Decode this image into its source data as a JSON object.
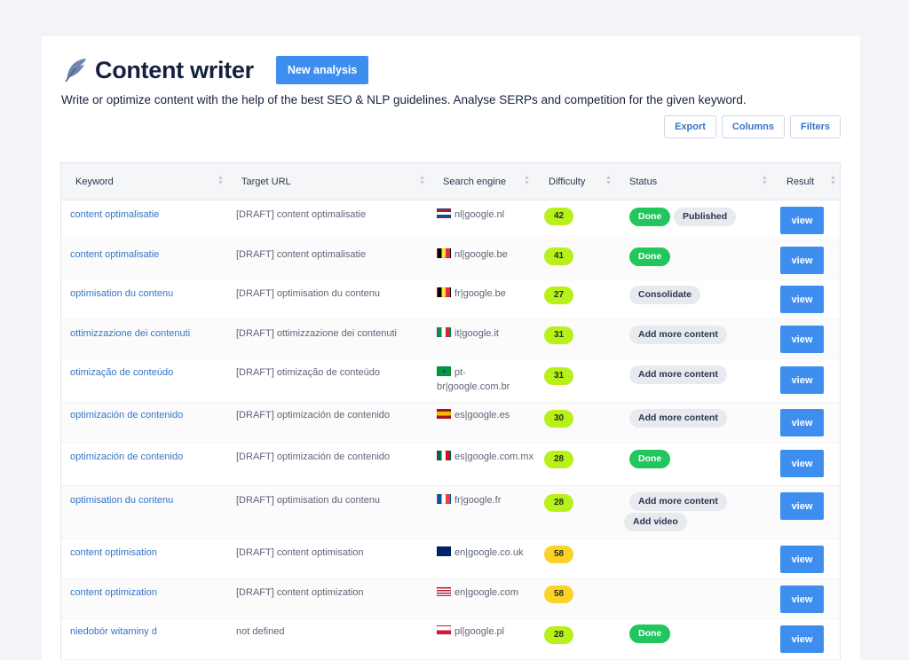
{
  "header": {
    "title": "Content writer",
    "new_analysis_label": "New analysis",
    "subtitle": "Write or optimize content with the help of the best SEO & NLP guidelines. Analyse SERPs and competition for the given keyword."
  },
  "toolbar": {
    "export_label": "Export",
    "columns_label": "Columns",
    "filters_label": "Filters"
  },
  "table": {
    "columns": [
      "Keyword",
      "Target URL",
      "Search engine",
      "Difficulty",
      "Status",
      "Result"
    ],
    "view_label": "view",
    "rows": [
      {
        "keyword": "content optimalisatie",
        "target_url": "[DRAFT] content optimalisatie",
        "flag": "nl",
        "engine": "nl|google.nl",
        "difficulty": "42",
        "status": [
          "Done",
          "Published"
        ]
      },
      {
        "keyword": "content optimalisatie",
        "target_url": "[DRAFT] content optimalisatie",
        "flag": "be",
        "engine": "nl|google.be",
        "difficulty": "41",
        "status": [
          "Done"
        ]
      },
      {
        "keyword": "optimisation du contenu",
        "target_url": "[DRAFT] optimisation du contenu",
        "flag": "be",
        "engine": "fr|google.be",
        "difficulty": "27",
        "status": [
          "Consolidate"
        ]
      },
      {
        "keyword": "ottimizzazione dei contenuti",
        "target_url": "[DRAFT] ottimizzazione dei contenuti",
        "flag": "it",
        "engine": "it|google.it",
        "difficulty": "31",
        "status": [
          "Add more content"
        ]
      },
      {
        "keyword": "otimização de conteúdo",
        "target_url": "[DRAFT] otimização de conteúdo",
        "flag": "br",
        "engine": "pt-br|google.com.br",
        "difficulty": "31",
        "status": [
          "Add more content"
        ]
      },
      {
        "keyword": "optimización de contenido",
        "target_url": "[DRAFT] optimización de contenido",
        "flag": "es",
        "engine": "es|google.es",
        "difficulty": "30",
        "status": [
          "Add more content"
        ]
      },
      {
        "keyword": "optimización de contenido",
        "target_url": "[DRAFT] optimización de contenido",
        "flag": "mx",
        "engine": "es|google.com.mx",
        "difficulty": "28",
        "status": [
          "Done"
        ]
      },
      {
        "keyword": "optimisation du contenu",
        "target_url": "[DRAFT] optimisation du contenu",
        "flag": "fr",
        "engine": "fr|google.fr",
        "difficulty": "28",
        "status": [
          "Add more content",
          "Add video"
        ]
      },
      {
        "keyword": "content optimisation",
        "target_url": "[DRAFT] content optimisation",
        "flag": "uk",
        "engine": "en|google.co.uk",
        "difficulty": "58",
        "status": []
      },
      {
        "keyword": "content optimization",
        "target_url": "[DRAFT] content optimization",
        "flag": "us",
        "engine": "en|google.com",
        "difficulty": "58",
        "status": []
      },
      {
        "keyword": "niedobór witaminy d",
        "target_url": "not defined",
        "flag": "pl",
        "engine": "pl|google.pl",
        "difficulty": "28",
        "status": [
          "Done"
        ]
      }
    ]
  },
  "colors": {
    "accent": "#3e8ef0",
    "link": "#3475c9",
    "status_done": "#22c55e",
    "difficulty_low": "#b8f01a",
    "difficulty_medium": "#fcd227"
  }
}
